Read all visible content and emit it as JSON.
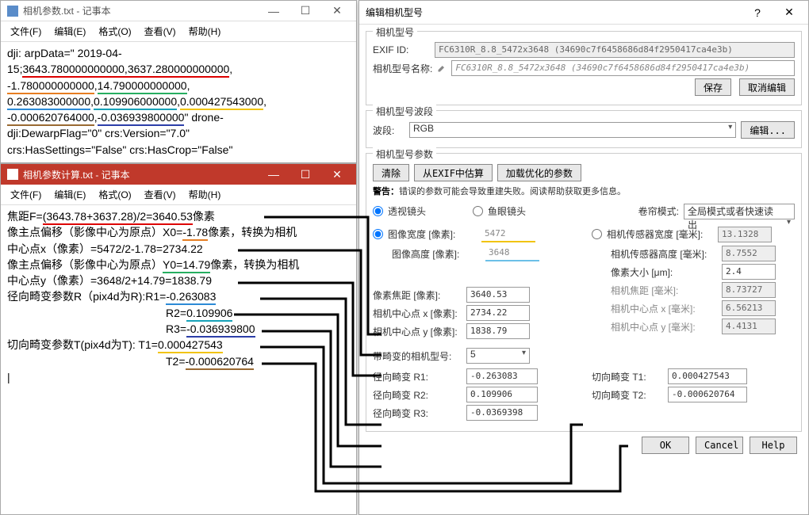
{
  "win1": {
    "title": "相机参数.txt - 记事本",
    "menu": [
      "文件(F)",
      "编辑(E)",
      "格式(O)",
      "查看(V)",
      "帮助(H)"
    ],
    "text": {
      "l1a": "dji: arpData=\" 2019-04-",
      "l2a": "15;",
      "l2b": "3643.780000000000,3637.280000000000",
      "l2c": ",",
      "l2d": "-1.780000000000",
      "l2e": ",",
      "l2f": "14.790000000000",
      "l2g": ",",
      "l3a": "0.263083000000",
      "l3b": ",",
      "l3c": "0.109906000000",
      "l3d": ",",
      "l3e": "0.000427543000",
      "l3f": ",",
      "l3g": "-0.000620764000",
      "l3h": ",",
      "l3i": "-0.036939800000",
      "l3j": "\"   drone-",
      "l4": "dji:DewarpFlag=\"0\"  crs:Version=\"7.0\"",
      "l5": "crs:HasSettings=\"False\"   crs:HasCrop=\"False\""
    }
  },
  "win2": {
    "title": "相机参数计算.txt - 记事本",
    "menu": [
      "文件(F)",
      "编辑(E)",
      "格式(O)",
      "查看(V)",
      "帮助(H)"
    ],
    "text": {
      "f1a": "焦距F=",
      "f1b": "(3643.78+3637.28)/2=3640.53",
      "f1c": "像素",
      "x0a": "像主点偏移（影像中心为原点）X0=",
      "x0b": "-1.78",
      "x0c": "像素，转换为相机",
      "xca": "中心点x（像素）=5472/2-1.78=2734.22",
      "y0a": "像主点偏移（影像中心为原点）",
      "y0b": "Y0=14.79",
      "y0c": "像素，转换为相机",
      "yca": "中心点y（像素）=3648/2+14.79=1838.79",
      "r1a": "径向畸变参数R（pix4d为R):R1=",
      "r1b": "-0.263083",
      "r2a": "R2=",
      "r2b": "0.109906",
      "r3a": "R3=",
      "r3b": "-0.036939800",
      "t1a": "切向畸变参数T(pix4d为T):  T1=",
      "t1b": "0.000427543",
      "t2a": "T2=",
      "t2b": "-0.000620764",
      "caret": "|"
    }
  },
  "win3": {
    "title": "编辑相机型号",
    "sec_model": "相机型号",
    "exif_lbl": "EXIF ID:",
    "exif_val": "FC6310R_8.8_5472x3648 (34690c7f6458686d84f2950417ca4e3b)",
    "name_lbl": "相机型号名称:",
    "name_val": "FC6310R_8.8_5472x3648 (34690c7f6458686d84f2950417ca4e3b)",
    "btn_save": "保存",
    "btn_cancel_edit": "取消编辑",
    "sec_band": "相机型号波段",
    "band_lbl": "波段:",
    "band_val": "RGB",
    "btn_edit": "编辑...",
    "sec_params": "相机型号参数",
    "btn_clear": "清除",
    "btn_exif": "从EXIF中估算",
    "btn_load": "加载优化的参数",
    "warn_bold": "警告：",
    "warn_text": "错误的参数可能会导致重建失败。阅读帮助获取更多信息。",
    "radio_persp": "透视镜头",
    "radio_fish": "鱼眼镜头",
    "shutter_lbl": "卷帘模式:",
    "shutter_val": "全局模式或者快速读出",
    "radio_imgw": "图像宽度 [像素]:",
    "imgw_val": "5472",
    "imgh_lbl": "图像高度 [像素]:",
    "imgh_val": "3648",
    "sensw_lbl": "相机传感器宽度 [毫米]:",
    "sensw_val": "13.1328",
    "sensh_lbl": "相机传感器高度 [毫米]:",
    "sensh_val": "8.7552",
    "pxsize_lbl": "像素大小 [μm]:",
    "pxsize_val": "2.4",
    "fpx_lbl": "像素焦距 [像素]:",
    "fpx_val": "3640.53",
    "fmm_lbl": "相机焦距 [毫米]:",
    "fmm_val": "8.73727",
    "cxpx_lbl": "相机中心点 x [像素]:",
    "cxpx_val": "2734.22",
    "cxmm_lbl": "相机中心点 x [毫米]:",
    "cxmm_val": "6.56213",
    "cypx_lbl": "相机中心点 y [像素]:",
    "cypx_val": "1838.79",
    "cymm_lbl": "相机中心点 y [毫米]:",
    "cymm_val": "4.4131",
    "dist_lbl": "带畸变的相机型号:",
    "dist_val": "5",
    "r1_lbl": "径向畸变 R1:",
    "r1_val": "-0.263083",
    "r2_lbl": "径向畸变 R2:",
    "r2_val": "0.109906",
    "r3_lbl": "径向畸变 R3:",
    "r3_val": "-0.0369398",
    "t1_lbl": "切向畸变 T1:",
    "t1_val": "0.000427543",
    "t2_lbl": "切向畸变 T2:",
    "t2_val": "-0.000620764",
    "btn_ok": "OK",
    "btn_cancel": "Cancel",
    "btn_help": "Help"
  },
  "glyph": {
    "min": "—",
    "max": "☐",
    "close": "✕"
  }
}
